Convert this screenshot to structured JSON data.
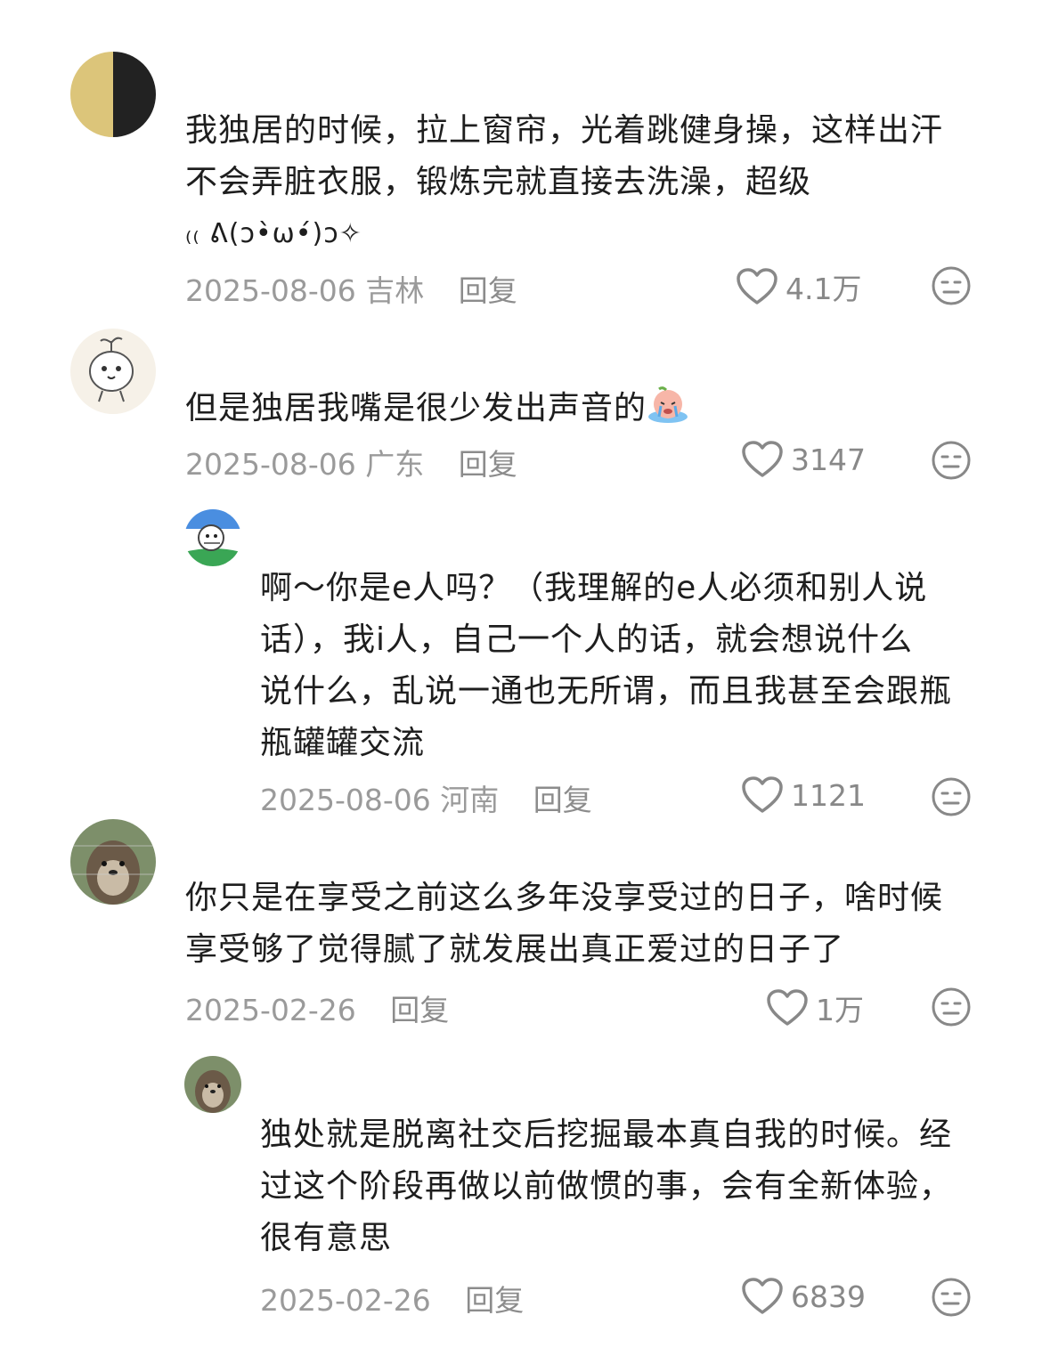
{
  "comments": [
    {
      "lines": [
        "我独居的时候，拉上窗帘，光着跳健身操，这样出汗",
        "不会弄脏衣服，锻炼完就直接去洗澡，超级",
        "₍₍ ᕕ(ↄ•̀ω•́)ↄ✧"
      ],
      "date": "2025-08-06",
      "location": "吉林",
      "reply": "回复",
      "likes": "4.1万"
    },
    {
      "lines": [
        "但是独居我嘴是很少发出声音的"
      ],
      "date": "2025-08-06",
      "location": "广东",
      "reply": "回复",
      "likes": "3147",
      "emoji": "crying-peach-emoji"
    },
    {
      "lines": [
        "啊～你是e人吗？（我理解的e人必须和别人说",
        "话），我i人，自己一个人的话，就会想说什么",
        "说什么，乱说一通也无所谓，而且我甚至会跟瓶",
        "瓶罐罐交流"
      ],
      "date": "2025-08-06",
      "location": "河南",
      "reply": "回复",
      "likes": "1121"
    },
    {
      "lines": [
        "你只是在享受之前这么多年没享受过的日子，啥时候",
        "享受够了觉得腻了就发展出真正爱过的日子了"
      ],
      "date": "2025-02-26",
      "location": "",
      "reply": "回复",
      "likes": "1万"
    },
    {
      "lines": [
        "独处就是脱离社交后挖掘最本真自我的时候。经",
        "过这个阶段再做以前做惯的事，会有全新体验，",
        "很有意思"
      ],
      "date": "2025-02-26",
      "location": "",
      "reply": "回复",
      "likes": "6839"
    }
  ],
  "icons": {
    "like": "heart-outline-icon",
    "dislike": "meh-face-icon"
  },
  "colors": {
    "meta_text": "#9a9a9a",
    "body_text": "#1e1e1e"
  }
}
